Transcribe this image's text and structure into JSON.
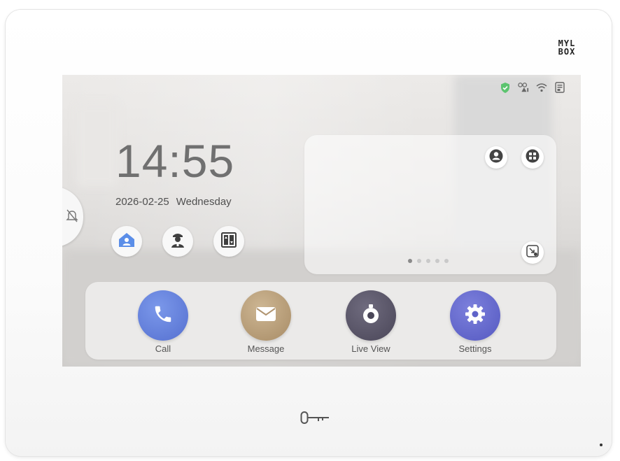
{
  "brand": {
    "line1": "MYL",
    "line2": "BOX"
  },
  "status_bar": {
    "icons": [
      "shield-check-icon",
      "sip-network-icon",
      "wifi-icon",
      "sd-card-icon"
    ],
    "shield_color": "#5cc46f"
  },
  "clock": {
    "time": "14:55",
    "date": "2026-02-25",
    "weekday": "Wednesday"
  },
  "side_tab": {
    "icon": "do-not-disturb-bell-icon"
  },
  "quick_actions": [
    {
      "name": "home-mode-button",
      "icon": "home-person-icon",
      "color": "#5b8ee8"
    },
    {
      "name": "call-management-button",
      "icon": "guard-icon",
      "color": "#3f3f3f"
    },
    {
      "name": "elevator-button",
      "icon": "elevator-icon",
      "color": "#3f3f3f"
    }
  ],
  "widget": {
    "buttons": [
      "contacts-icon",
      "apps-grid-icon",
      "minimize-icon"
    ],
    "page_dots": {
      "count": 5,
      "active": 1
    }
  },
  "dock": {
    "apps": [
      {
        "label": "Call",
        "icon": "phone-icon",
        "color": "#5f7ed9"
      },
      {
        "label": "Message",
        "icon": "envelope-icon",
        "color": "#b49a76"
      },
      {
        "label": "Live View",
        "icon": "camera-lens-icon",
        "color": "#565264"
      },
      {
        "label": "Settings",
        "icon": "gear-icon",
        "color": "#5f63c9"
      }
    ]
  },
  "hardware": {
    "unlock_icon": "key-icon"
  }
}
